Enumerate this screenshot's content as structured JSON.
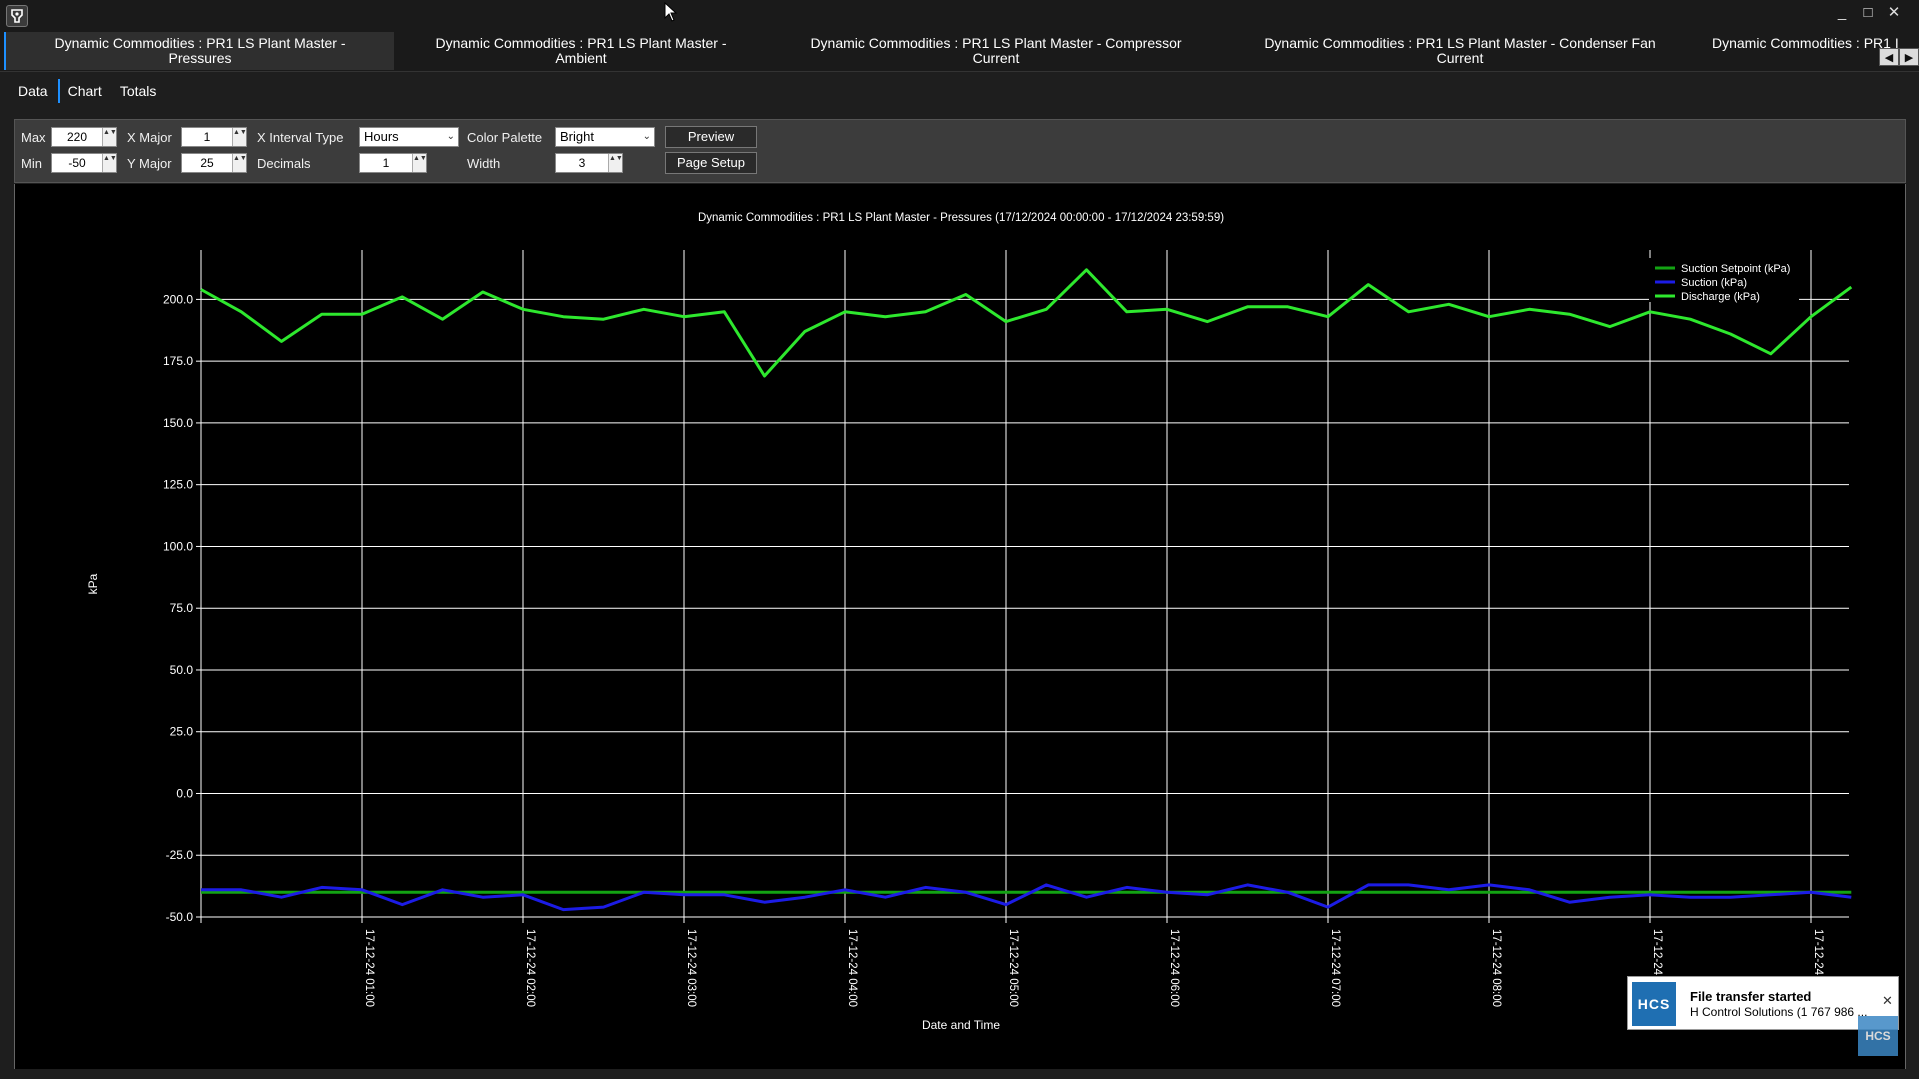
{
  "window": {
    "minimize": "_",
    "maximize": "□",
    "close": "✕"
  },
  "doc_tabs": [
    {
      "line1": "Dynamic Commodities : PR1 LS Plant Master -",
      "line2": "Pressures"
    },
    {
      "line1": "Dynamic Commodities : PR1 LS Plant Master -",
      "line2": "Ambient"
    },
    {
      "line1": "Dynamic Commodities : PR1 LS Plant Master - Compressor",
      "line2": "Current"
    },
    {
      "line1": "Dynamic Commodities : PR1 LS Plant Master - Condenser Fan",
      "line2": "Current"
    },
    {
      "line1": "Dynamic Commodities : PR1 I",
      "line2": ""
    }
  ],
  "tab_scroll": {
    "left": "◀",
    "right": "▶"
  },
  "view_tabs": [
    "Data",
    "Chart",
    "Totals"
  ],
  "toolbar": {
    "max_label": "Max",
    "max_value": "220",
    "min_label": "Min",
    "min_value": "-50",
    "xmajor_label": "X Major",
    "xmajor_value": "1",
    "ymajor_label": "Y Major",
    "ymajor_value": "25",
    "xinterval_label": "X Interval Type",
    "xinterval_value": "Hours",
    "decimals_label": "Decimals",
    "decimals_value": "1",
    "palette_label": "Color Palette",
    "palette_value": "Bright",
    "width_label": "Width",
    "width_value": "3",
    "preview_label": "Preview",
    "pagesetup_label": "Page Setup",
    "spin_arrows": "▲▼",
    "caret": "⌄"
  },
  "chart_data": {
    "type": "line",
    "title": "Dynamic Commodities : PR1 LS Plant Master - Pressures    (17/12/2024 00:00:00 - 17/12/2024 23:59:59)",
    "xlabel": "Date and Time",
    "ylabel": "kPa",
    "ylim": [
      -50,
      220
    ],
    "yticks": [
      "200.0",
      "175.0",
      "150.0",
      "125.0",
      "100.0",
      "75.0",
      "50.0",
      "25.0",
      "0.0",
      "-25.0",
      "-50.0"
    ],
    "xticks": [
      "17-12-24 01:00",
      "17-12-24 02:00",
      "17-12-24 03:00",
      "17-12-24 04:00",
      "17-12-24 05:00",
      "17-12-24 06:00",
      "17-12-24 07:00",
      "17-12-24 08:00",
      "17-12-24",
      "17-12-24"
    ],
    "x_hours": [
      0,
      0.25,
      0.5,
      0.75,
      1,
      1.25,
      1.5,
      1.75,
      2,
      2.25,
      2.5,
      2.75,
      3,
      3.25,
      3.5,
      3.75,
      4,
      4.25,
      4.5,
      4.75,
      5,
      5.25,
      5.5,
      5.75,
      6,
      6.25,
      6.5,
      6.75,
      7,
      7.25,
      7.5,
      7.75,
      8,
      8.25,
      8.5,
      8.75,
      9,
      9.25,
      9.5,
      9.75,
      10,
      10.25
    ],
    "legend_position": "top-right",
    "series": [
      {
        "name": "Suction Setpoint (kPa)",
        "color": "#13a313",
        "values": [
          -40,
          -40,
          -40,
          -40,
          -40,
          -40,
          -40,
          -40,
          -40,
          -40,
          -40,
          -40,
          -40,
          -40,
          -40,
          -40,
          -40,
          -40,
          -40,
          -40,
          -40,
          -40,
          -40,
          -40,
          -40,
          -40,
          -40,
          -40,
          -40,
          -40,
          -40,
          -40,
          -40,
          -40,
          -40,
          -40,
          -40,
          -40,
          -40,
          -40,
          -40,
          -40
        ]
      },
      {
        "name": "Suction (kPa)",
        "color": "#1c1ce6",
        "values": [
          -39,
          -39,
          -42,
          -38,
          -39,
          -45,
          -39,
          -42,
          -41,
          -47,
          -46,
          -40,
          -41,
          -41,
          -44,
          -42,
          -39,
          -42,
          -38,
          -40,
          -45,
          -37,
          -42,
          -38,
          -40,
          -41,
          -37,
          -40,
          -46,
          -37,
          -37,
          -39,
          -37,
          -39,
          -44,
          -42,
          -41,
          -42,
          -42,
          -41,
          -40,
          -42
        ]
      },
      {
        "name": "Discharge (kPa)",
        "color": "#2ee82e",
        "values": [
          204,
          195,
          183,
          194,
          194,
          201,
          192,
          203,
          196,
          193,
          192,
          196,
          193,
          195,
          169,
          187,
          195,
          193,
          195,
          202,
          191,
          196,
          212,
          195,
          196,
          191,
          197,
          197,
          193,
          206,
          195,
          198,
          193,
          196,
          194,
          189,
          195,
          192,
          186,
          178,
          193,
          205
        ]
      }
    ]
  },
  "toast": {
    "logo": "HCS",
    "title": "File transfer started",
    "message": "H Control Solutions (1 767 986 ...",
    "close": "✕"
  },
  "tray_logo": "HCS"
}
